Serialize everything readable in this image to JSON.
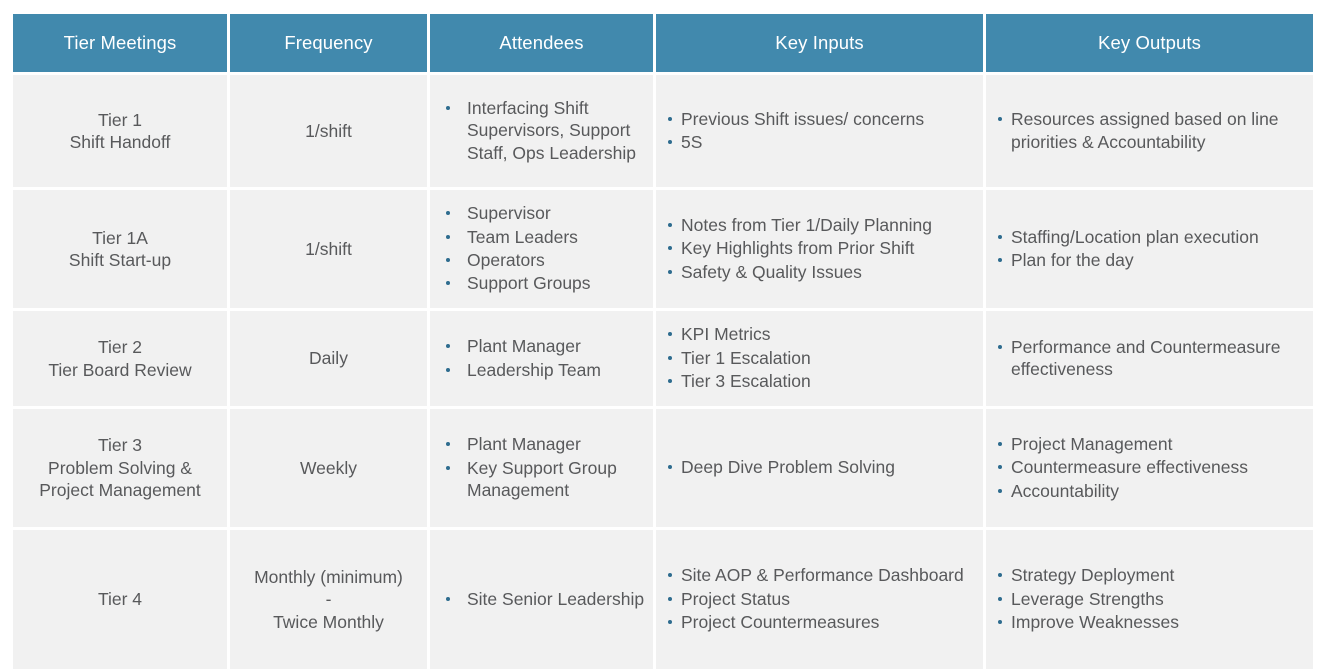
{
  "table": {
    "headers": [
      {
        "line1": "Tier",
        "line2": "Meetings"
      },
      {
        "line1": "Frequency",
        "line2": ""
      },
      {
        "line1": "Attendees",
        "line2": ""
      },
      {
        "line1": "Key Inputs",
        "line2": ""
      },
      {
        "line1": "Key Outputs",
        "line2": ""
      }
    ],
    "rows": [
      {
        "tier_line1": "Tier 1",
        "tier_line2": "Shift Handoff",
        "tier_line3": "",
        "frequency_line1": "1/shift",
        "frequency_line2": "",
        "frequency_line3": "",
        "attendees": [
          "Interfacing Shift Supervisors, Support Staff, Ops Leadership"
        ],
        "key_inputs": [
          "Previous Shift issues/ concerns",
          "5S"
        ],
        "key_outputs": [
          "Resources assigned based on line priorities & Accountability"
        ]
      },
      {
        "tier_line1": "Tier 1A",
        "tier_line2": "Shift Start-up",
        "tier_line3": "",
        "frequency_line1": "1/shift",
        "frequency_line2": "",
        "frequency_line3": "",
        "attendees": [
          "Supervisor",
          "Team Leaders",
          "Operators",
          "Support Groups"
        ],
        "key_inputs": [
          "Notes from Tier 1/Daily Planning",
          "Key Highlights from Prior Shift",
          "Safety & Quality Issues"
        ],
        "key_outputs": [
          "Staffing/Location plan execution",
          "Plan for the day"
        ]
      },
      {
        "tier_line1": "Tier 2",
        "tier_line2": "Tier Board Review",
        "tier_line3": "",
        "frequency_line1": "Daily",
        "frequency_line2": "",
        "frequency_line3": "",
        "attendees": [
          "Plant Manager",
          "Leadership Team"
        ],
        "key_inputs": [
          "KPI Metrics",
          "Tier 1 Escalation",
          "Tier 3 Escalation"
        ],
        "key_outputs": [
          "Performance and Countermeasure effectiveness"
        ]
      },
      {
        "tier_line1": "Tier 3",
        "tier_line2": "Problem Solving &",
        "tier_line3": "Project Management",
        "frequency_line1": "Weekly",
        "frequency_line2": "",
        "frequency_line3": "",
        "attendees": [
          "Plant Manager",
          "Key Support Group Management"
        ],
        "key_inputs": [
          "Deep Dive Problem Solving"
        ],
        "key_outputs": [
          "Project Management",
          "Countermeasure effectiveness",
          "Accountability"
        ]
      },
      {
        "tier_line1": "Tier 4",
        "tier_line2": "",
        "tier_line3": "",
        "frequency_line1": "Monthly (minimum)",
        "frequency_line2": "-",
        "frequency_line3": "Twice Monthly",
        "attendees": [
          "Site Senior Leadership"
        ],
        "key_inputs": [
          "Site AOP & Performance Dashboard",
          "Project Status",
          "Project Countermeasures"
        ],
        "key_outputs": [
          "Strategy Deployment",
          "Leverage Strengths",
          "Improve Weaknesses"
        ]
      }
    ]
  },
  "colors": {
    "header_background": "#4189AD",
    "header_text": "#FFFFFF",
    "cell_background": "#F1F1F1",
    "cell_text": "#58595B",
    "bullet": "#2E6C8E",
    "page_background": "#FFFFFF"
  }
}
